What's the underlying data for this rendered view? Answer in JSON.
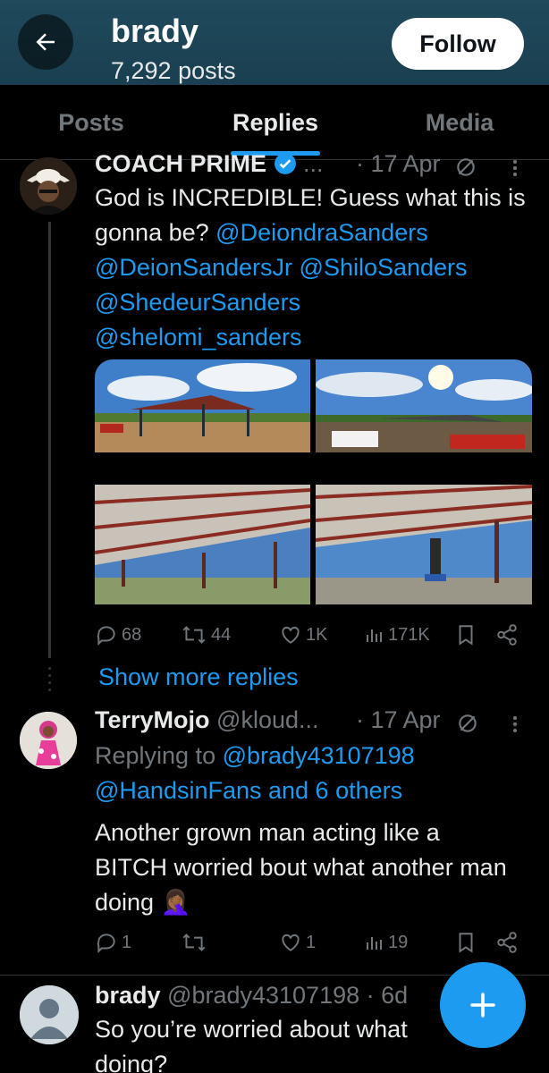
{
  "header": {
    "name": "brady",
    "posts_count": "7,292 posts",
    "follow_label": "Follow"
  },
  "tabs": [
    {
      "label": "Posts",
      "active": false
    },
    {
      "label": "Replies",
      "active": true
    },
    {
      "label": "Media",
      "active": false
    }
  ],
  "posts": [
    {
      "author": "COACH PRIME",
      "verified": true,
      "handle": "...",
      "date": "· 17 Apr",
      "text": "God is INCREDIBLE! Guess what this is gonna be?",
      "mentions": [
        "@DeiondraSanders",
        "@DeionSandersJr",
        "@ShiloSanders",
        "@ShedeurSanders",
        "@shelomi_sanders"
      ],
      "media_count": 4,
      "stats": {
        "replies": "68",
        "reposts": "44",
        "likes": "1K",
        "views": "171K"
      }
    },
    {
      "author": "TerryMojo",
      "handle": "@kloud...",
      "date": "· 17 Apr",
      "replying_prefix": "Replying to",
      "replying_to": "@brady43107198",
      "replying_more": "@HandsinFans and 6 others",
      "text": "Another grown man acting like a BITCH worried bout what another man doing 🤦🏾‍♀️",
      "stats": {
        "replies": "1",
        "reposts": "",
        "likes": "1",
        "views": "19"
      }
    },
    {
      "author": "brady",
      "handle": "@brady43107198",
      "date": "· 6d",
      "text": "So you’re worried about what doing?"
    }
  ],
  "show_more_label": "Show more replies",
  "colors": {
    "accent": "#1d9bf0",
    "muted": "#71767b",
    "header_bg": "#1f4a5c"
  }
}
